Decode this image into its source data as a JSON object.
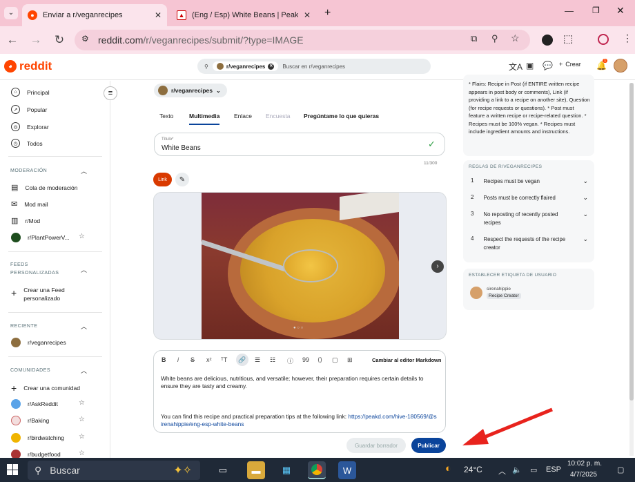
{
  "browser": {
    "tabs": [
      {
        "label": "Enviar a r/veganrecipes",
        "active": true
      },
      {
        "label": "(Eng / Esp) White Beans | PeakD",
        "active": false
      }
    ],
    "url_host": "reddit.com",
    "url_path": "/r/veganrecipes/submit/?type=IMAGE"
  },
  "reddit": {
    "logo": "reddit",
    "search_chip": "r/veganrecipes",
    "search_placeholder": "Buscar en r/veganrecipes",
    "create_label": "Crear",
    "notif_count": "1"
  },
  "sidebar": {
    "nav": [
      {
        "label": "Principal",
        "icon": "home-icon"
      },
      {
        "label": "Popular",
        "icon": "popular-icon"
      },
      {
        "label": "Explorar",
        "icon": "explore-icon"
      },
      {
        "label": "Todos",
        "icon": "all-icon"
      }
    ],
    "mod_title": "MODERACIÓN",
    "mod": [
      "Cola de moderación",
      "Mod mail",
      "r/Mod",
      "r/PlantPowerV..."
    ],
    "feeds_title": "FEEDS PERSONALIZADAS",
    "create_feed": "Crear una Feed personalizado",
    "recent_title": "RECIENTE",
    "recent": [
      "r/veganrecipes"
    ],
    "communities_title": "COMUNIDADES",
    "create_community": "Crear una comunidad",
    "communities": [
      "r/AskReddit",
      "r/Baking",
      "r/birdwatching",
      "r/budgetfood"
    ]
  },
  "post": {
    "subreddit": "r/veganrecipes",
    "tabs": [
      "Texto",
      "Multimedia",
      "Enlace",
      "Encuesta",
      "Pregúntame lo que quieras"
    ],
    "active_tab": "Multimedia",
    "title_label": "Título*",
    "title_value": "White Beans",
    "title_count": "11/300",
    "link_label": "Link",
    "switch_editor": "Cambiar al editor Markdown",
    "body_p1": "White beans are delicious, nutritious, and versatile; however, their preparation requires certain details to ensure they are tasty and creamy.",
    "body_p2_text": "You can find this recipe and practical preparation tips at the following link: ",
    "body_p2_link": "https://peakd.com/hive-180569/@sirenahippie/eng-esp-white-beans",
    "save_draft": "Guardar borrador",
    "publish": "Publicar"
  },
  "rightbar": {
    "flair_text": "* Flairs: Recipe in Post (if ENTIRE written recipe appears in post body or comments), Link (if providing a link to a recipe on another site), Question (for recipe requests or questions). * Post must feature a written recipe or recipe-related question. * Recipes must be 100% vegan. * Recipes must include ingredient amounts and instructions.",
    "rules_title": "REGLAS DE R/VEGANRECIPES",
    "rules": [
      {
        "n": "1",
        "text": "Recipes must be vegan"
      },
      {
        "n": "2",
        "text": "Posts must be correctly flaired"
      },
      {
        "n": "3",
        "text": "No reposting of recently posted recipes"
      },
      {
        "n": "4",
        "text": "Respect the requests of the recipe creator"
      }
    ],
    "user_flair_title": "ESTABLECER ETIQUETA DE USUARIO",
    "username": "sirenahippie",
    "user_flair": "Recipe Creator"
  },
  "taskbar": {
    "search": "Buscar",
    "temp": "24°C",
    "lang": "ESP",
    "time": "10:02 p. m.",
    "date": "4/7/2025"
  },
  "colors": {
    "reddit_orange": "#ff4500",
    "publish_blue": "#0a449b",
    "chrome_pink": "#f6c5d3",
    "annotation_red": "#e8231d"
  }
}
